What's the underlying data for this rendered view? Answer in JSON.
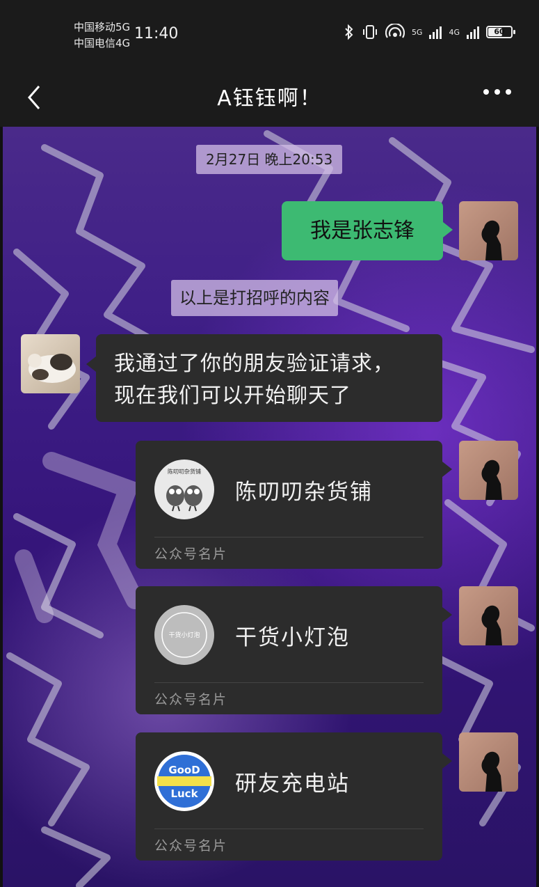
{
  "status_bar": {
    "carrier1": "中国移动5G",
    "carrier2": "中国电信4G",
    "time": "11:40",
    "net1": "5G",
    "net2": "4G",
    "battery": "60"
  },
  "header": {
    "title": "A钰钰啊！"
  },
  "chat": {
    "timestamp": "2月27日 晚上20:53",
    "messages": [
      {
        "text": "我是张志锋"
      },
      {
        "text_line1": "我通过了你的朋友验证请求，",
        "text_line2": "现在我们可以开始聊天了"
      }
    ],
    "notice": "以上是打招呼的内容",
    "cards": [
      {
        "name": "陈叨叨杂货铺",
        "type": "公众号名片",
        "logo_text": "陈叨叨杂货铺"
      },
      {
        "name": "干货小灯泡",
        "type": "公众号名片",
        "logo_text": "干货小灯泡"
      },
      {
        "name": "研友充电站",
        "type": "公众号名片",
        "logo_text_top": "GooD",
        "logo_text_bottom": "Luck"
      }
    ]
  },
  "colors": {
    "green_bubble": "#3dba72",
    "dark_bubble": "#2c2c2c",
    "bar": "#1b1b1b"
  }
}
